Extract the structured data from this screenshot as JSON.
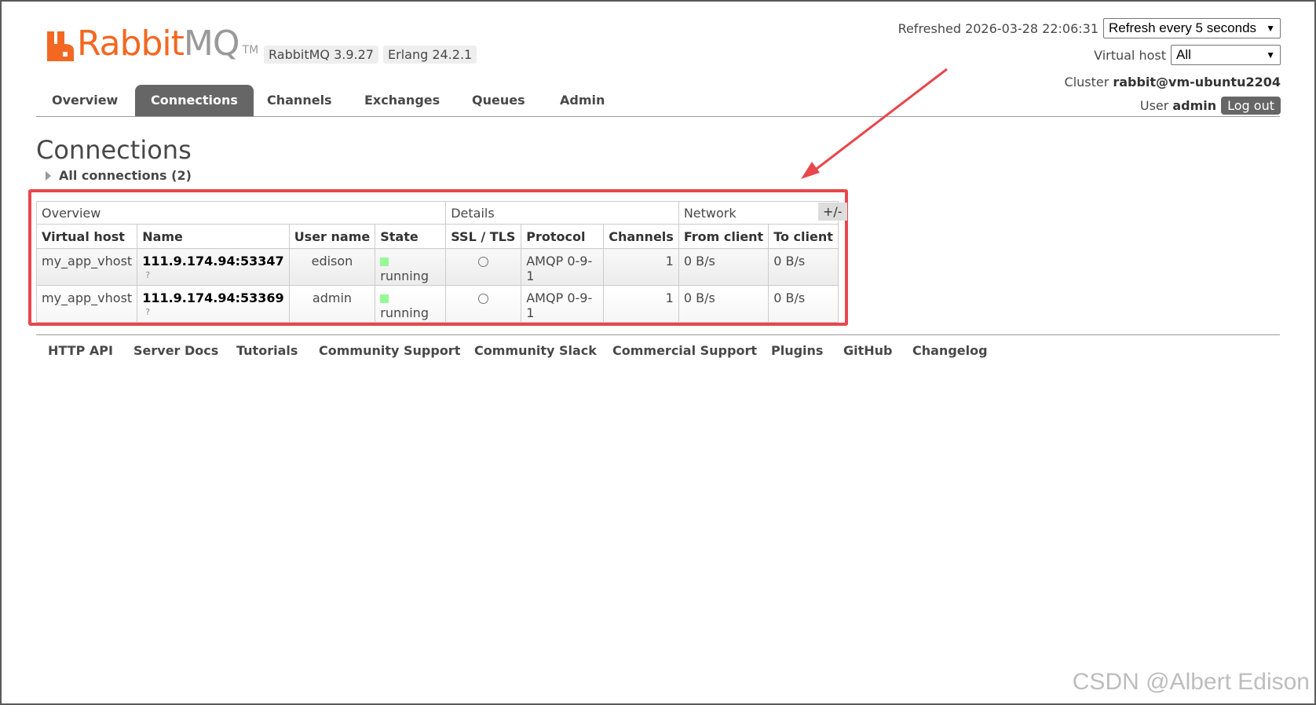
{
  "app": {
    "logo_rabbit": "Rabbit",
    "logo_mq": "MQ",
    "logo_tm": "TM",
    "version": "RabbitMQ 3.9.27",
    "erlang": "Erlang 24.2.1"
  },
  "status": {
    "refreshed_label": "Refreshed 2026-03-28 22:06:31",
    "refresh_select": "Refresh every 5 seconds",
    "vhost_label": "Virtual host",
    "vhost_select": "All",
    "cluster_label": "Cluster",
    "cluster_value": "rabbit@vm-ubuntu2204",
    "user_label": "User",
    "user_value": "admin",
    "logout": "Log out"
  },
  "tabs": [
    {
      "label": "Overview",
      "active": false
    },
    {
      "label": "Connections",
      "active": true
    },
    {
      "label": "Channels",
      "active": false
    },
    {
      "label": "Exchanges",
      "active": false
    },
    {
      "label": "Queues",
      "active": false
    },
    {
      "label": "Admin",
      "active": false
    }
  ],
  "page": {
    "title": "Connections",
    "section": "All connections (2)"
  },
  "table": {
    "groups": [
      "Overview",
      "Details",
      "Network"
    ],
    "toggle": "+/-",
    "columns": [
      "Virtual host",
      "Name",
      "User name",
      "State",
      "SSL / TLS",
      "Protocol",
      "Channels",
      "From client",
      "To client"
    ],
    "rows": [
      {
        "vhost": "my_app_vhost",
        "name": "111.9.174.94:53347",
        "help": "?",
        "user": "edison",
        "state": "running",
        "protocol": "AMQP 0-9-1",
        "channels": "1",
        "from_client": "0 B/s",
        "to_client": "0 B/s"
      },
      {
        "vhost": "my_app_vhost",
        "name": "111.9.174.94:53369",
        "help": "?",
        "user": "admin",
        "state": "running",
        "protocol": "AMQP 0-9-1",
        "channels": "1",
        "from_client": "0 B/s",
        "to_client": "0 B/s"
      }
    ]
  },
  "footer": [
    "HTTP API",
    "Server Docs",
    "Tutorials",
    "Community Support",
    "Community Slack",
    "Commercial Support",
    "Plugins",
    "GitHub",
    "Changelog"
  ],
  "watermark": "CSDN @Albert Edison",
  "colors": {
    "brand": "#f26822",
    "highlight": "#e8474c",
    "running": "#98f898"
  }
}
